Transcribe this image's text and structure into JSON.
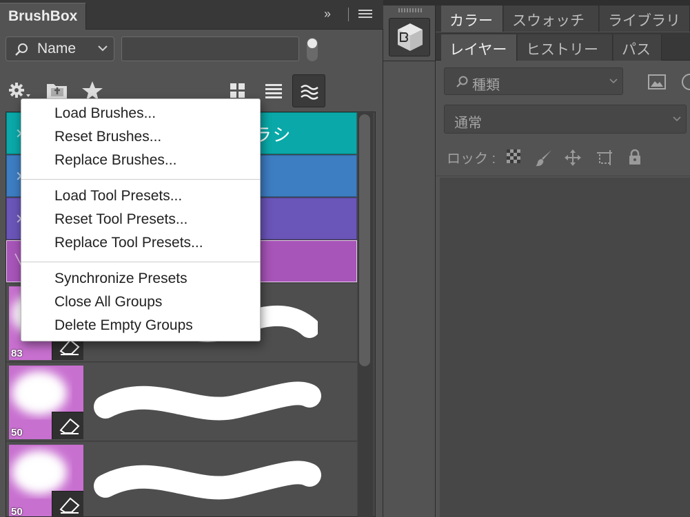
{
  "brushbox": {
    "title": "BrushBox",
    "collapse_glyph": "››",
    "filter": {
      "label": "Name",
      "value": ""
    },
    "toolbar_icons": [
      "gear-icon",
      "new-group-folder-icon",
      "favorite-star-icon",
      "grid-view-icon",
      "list-view-icon",
      "stroke-view-icon"
    ],
    "groups": [
      {
        "name": "ラシ",
        "color": "#0aa8a8"
      },
      {
        "name": "",
        "color": "#3d7dc2"
      },
      {
        "name": "",
        "color": "#6a55b8"
      },
      {
        "name": "",
        "color": "#a755b8"
      }
    ],
    "brushes": [
      {
        "size": "83"
      },
      {
        "size": "50"
      },
      {
        "size": "50"
      }
    ]
  },
  "context_menu": {
    "items": [
      "Load Brushes...",
      "Reset Brushes...",
      "Replace Brushes...",
      "Load Tool Presets...",
      "Reset Tool Presets...",
      "Replace Tool Presets...",
      "Synchronize Presets",
      "Close All Groups",
      "Delete Empty Groups"
    ]
  },
  "right_panel": {
    "tabs_row1": [
      "カラー",
      "スウォッチ",
      "ライブラリ"
    ],
    "tabs_row2": [
      "レイヤー",
      "ヒストリー",
      "パス"
    ],
    "kind_label": "種類",
    "blend_mode": "通常",
    "lock_label": "ロック :"
  },
  "colors": {
    "panel_bg": "#535353",
    "dark_bg": "#383838",
    "brush_pink": "#c870d0",
    "menu_bg": "#ffffff"
  }
}
